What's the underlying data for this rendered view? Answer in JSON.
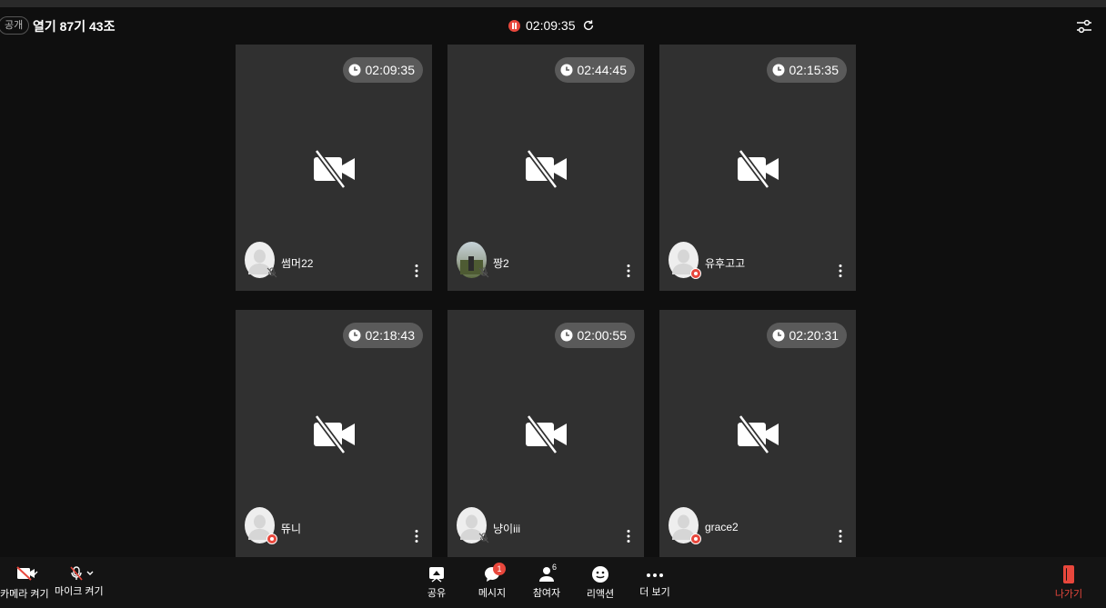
{
  "header": {
    "visibility_badge": "공개",
    "room_title": "열기 87기 43조",
    "recording_time": "02:09:35"
  },
  "participants": [
    {
      "name": "썸머22",
      "timer": "02:09:35",
      "avatar": "default",
      "status": "mic-muted"
    },
    {
      "name": "짱2",
      "timer": "02:44:45",
      "avatar": "photo",
      "status": "mic-muted"
    },
    {
      "name": "유후고고",
      "timer": "02:15:35",
      "avatar": "default",
      "status": "host"
    },
    {
      "name": "뜌니",
      "timer": "02:18:43",
      "avatar": "default",
      "status": "host"
    },
    {
      "name": "냥이iii",
      "timer": "02:00:55",
      "avatar": "default",
      "status": "mic-muted"
    },
    {
      "name": "grace2",
      "timer": "02:20:31",
      "avatar": "default",
      "status": "host"
    }
  ],
  "toolbar": {
    "camera_label": "카메라 켜기",
    "mic_label": "마이크 켜기",
    "share_label": "공유",
    "message_label": "메시지",
    "message_count": "1",
    "participants_label": "참여자",
    "participants_count": "6",
    "reaction_label": "리액션",
    "more_label": "더 보기",
    "leave_label": "나가기"
  },
  "colors": {
    "background": "#0f0f0f",
    "tile": "#303030",
    "accent_red": "#e8473c",
    "timer_pill": "#5a5a5a"
  }
}
